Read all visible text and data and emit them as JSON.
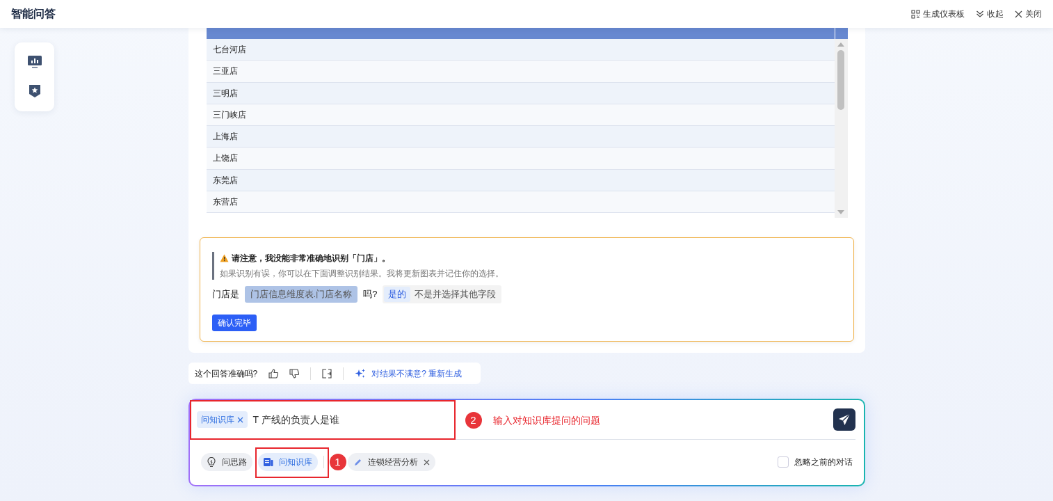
{
  "header": {
    "title": "智能问答",
    "actions": [
      "生成仪表板",
      "收起",
      "关闭"
    ]
  },
  "table": {
    "rows": [
      "七台河店",
      "三亚店",
      "三明店",
      "三门峡店",
      "上海店",
      "上饶店",
      "东莞店",
      "东营店"
    ]
  },
  "notice": {
    "title": "请注意，我没能非常准确地识别「门店」。",
    "body": "如果识别有误，你可以在下面调整识别结果。我将更新图表并记住你的选择。",
    "prefix": "门店是",
    "field": "门店信息维度表.门店名称",
    "suffix": "吗?",
    "options": [
      {
        "label": "是的",
        "selected": true
      },
      {
        "label": "不是并选择其他字段",
        "selected": false
      }
    ],
    "confirm": "确认完毕"
  },
  "feedback": {
    "question": "这个回答准确吗?",
    "regenerate": "对结果不满意? 重新生成"
  },
  "composer": {
    "tag": "问知识库",
    "text": "T 产线的负责人是谁",
    "modes": [
      {
        "label": "问思路",
        "selected": false,
        "removable": false
      },
      {
        "label": "问知识库",
        "selected": true,
        "removable": false
      },
      {
        "label": "连锁经营分析",
        "selected": false,
        "removable": true
      }
    ],
    "ignore_history": {
      "label": "忽略之前的对话",
      "checked": false
    }
  },
  "annotations": [
    {
      "number": "1"
    },
    {
      "number": "2",
      "text": "输入对知识库提问的问题"
    }
  ]
}
